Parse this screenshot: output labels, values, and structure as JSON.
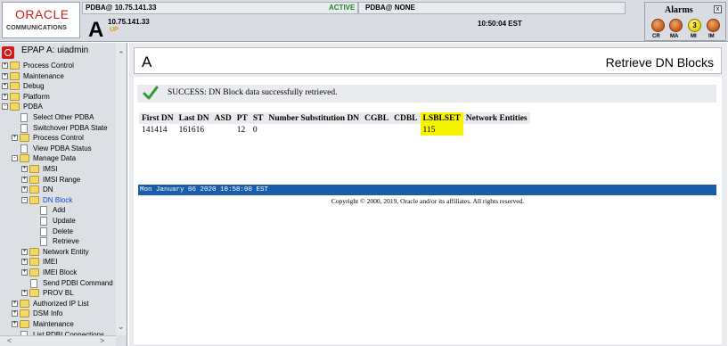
{
  "header": {
    "logo_oracle": "ORACLE",
    "logo_communications": "COMMUNICATIONS",
    "pdba_ip_label": "PDBA@ 10.75.141.33",
    "status": "ACTIVE",
    "pdba_none": "PDBA@ NONE",
    "big_letter": "A",
    "ip": "10.75.141.33",
    "up": "UP",
    "time": "10:50:04 EST"
  },
  "alarms": {
    "title": "Alarms",
    "minimize": "x",
    "items": [
      {
        "label": "CR",
        "count": ""
      },
      {
        "label": "MA",
        "count": ""
      },
      {
        "label": "MI",
        "count": "3"
      },
      {
        "label": "IM",
        "count": ""
      }
    ]
  },
  "sidebar": {
    "user": "EPAP A: uiadmin",
    "items": [
      {
        "label": "Process Control",
        "type": "folder",
        "toggle": "+"
      },
      {
        "label": "Maintenance",
        "type": "folder",
        "toggle": "+"
      },
      {
        "label": "Debug",
        "type": "folder",
        "toggle": "+"
      },
      {
        "label": "Platform",
        "type": "folder",
        "toggle": "+"
      },
      {
        "label": "PDBA",
        "type": "folder",
        "toggle": "-"
      },
      {
        "label": "Select Other PDBA",
        "type": "page"
      },
      {
        "label": "Switchover PDBA State",
        "type": "page"
      },
      {
        "label": "Process Control",
        "type": "folder",
        "toggle": "+"
      },
      {
        "label": "View PDBA Status",
        "type": "page"
      },
      {
        "label": "Manage Data",
        "type": "folder",
        "toggle": "-"
      },
      {
        "label": "IMSI",
        "type": "folder",
        "toggle": "+"
      },
      {
        "label": "IMSI Range",
        "type": "folder",
        "toggle": "+"
      },
      {
        "label": "DN",
        "type": "folder",
        "toggle": "+"
      },
      {
        "label": "DN Block",
        "type": "folder",
        "toggle": "-"
      },
      {
        "label": "Add",
        "type": "page"
      },
      {
        "label": "Update",
        "type": "page"
      },
      {
        "label": "Delete",
        "type": "page"
      },
      {
        "label": "Retrieve",
        "type": "page"
      },
      {
        "label": "Network Entity",
        "type": "folder",
        "toggle": "+"
      },
      {
        "label": "IMEI",
        "type": "folder",
        "toggle": "+"
      },
      {
        "label": "IMEI Block",
        "type": "folder",
        "toggle": "+"
      },
      {
        "label": "Send PDBI Command",
        "type": "page"
      },
      {
        "label": "PROV BL",
        "type": "folder",
        "toggle": "+"
      },
      {
        "label": "Authorized IP List",
        "type": "folder",
        "toggle": "+"
      },
      {
        "label": "DSM Info",
        "type": "folder",
        "toggle": "+"
      },
      {
        "label": "Maintenance",
        "type": "folder",
        "toggle": "+"
      },
      {
        "label": "List PDBI Connections",
        "type": "page"
      }
    ]
  },
  "main": {
    "title_left": "A",
    "title_right": "Retrieve DN Blocks",
    "success_message": "SUCCESS: DN Block data successfully retrieved.",
    "table": {
      "columns": [
        "First DN",
        "Last DN",
        "ASD",
        "PT",
        "ST",
        "Number Substitution DN",
        "CGBL",
        "CDBL",
        "LSBLSET",
        "Network Entities"
      ],
      "rows": [
        [
          "141414",
          "161616",
          "",
          "12",
          "0",
          "",
          "",
          "",
          "115",
          ""
        ]
      ]
    },
    "date_bar": "Mon January 06 2020 10:50:00 EST",
    "copyright": "Copyright © 2000, 2019, Oracle and/or its affiliates. All rights reserved."
  },
  "colors": {
    "oracle_red": "#d11b1b",
    "active_green": "#1f8a1f",
    "date_bar_blue": "#1a5eab",
    "highlight_yellow": "#f7f400",
    "selected_link": "#1b3fcf"
  }
}
